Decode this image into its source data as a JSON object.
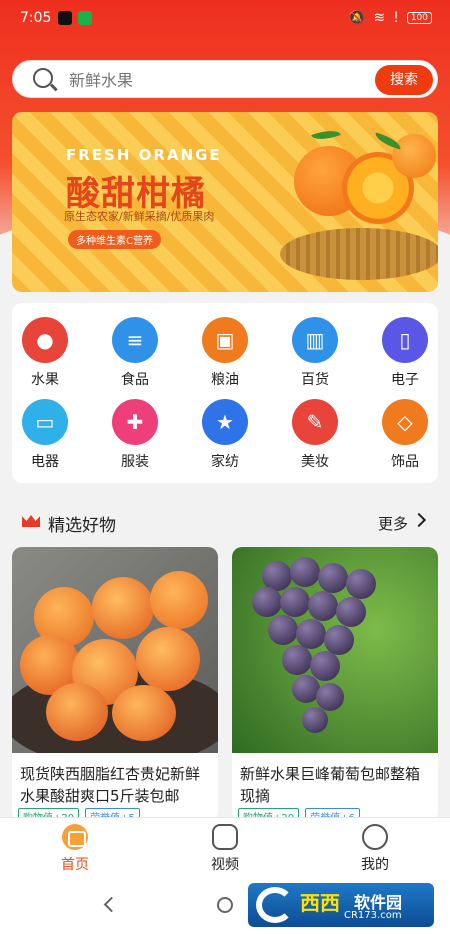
{
  "status_bar": {
    "time": "7:05",
    "battery": "100"
  },
  "search": {
    "placeholder": "新鲜水果",
    "button_label": "搜索"
  },
  "banner": {
    "en_word1": "FRESH",
    "en_word2": "ORANGE",
    "title_part1": "酸甜",
    "title_part2": "柑橘",
    "subtitle": "原生态农家/新鲜采摘/优质果肉",
    "tag": "多种维生素C营养"
  },
  "categories": [
    {
      "label": "水果",
      "icon": "apple-icon",
      "color": "#e8443a"
    },
    {
      "label": "食品",
      "icon": "fries-icon",
      "color": "#2f92e8"
    },
    {
      "label": "粮油",
      "icon": "grain-bag-icon",
      "color": "#f07a1e"
    },
    {
      "label": "百货",
      "icon": "basket-icon",
      "color": "#2f92e8"
    },
    {
      "label": "电子",
      "icon": "phone-icon",
      "color": "#5a57e6"
    },
    {
      "label": "电器",
      "icon": "tv-icon",
      "color": "#2fb0e8"
    },
    {
      "label": "服装",
      "icon": "shirt-icon",
      "color": "#ee3f7a"
    },
    {
      "label": "家纺",
      "icon": "textile-icon",
      "color": "#2f73e8"
    },
    {
      "label": "美妆",
      "icon": "cosmetics-icon",
      "color": "#e8443a"
    },
    {
      "label": "饰品",
      "icon": "necklace-icon",
      "color": "#f07a1e"
    }
  ],
  "section": {
    "title": "精选好物",
    "more_label": "更多"
  },
  "products": [
    {
      "name": "现货陕西胭脂红杏贵妃新鲜水果酸甜爽口5斤装包邮",
      "badges": [
        "购物值+20",
        "荣誉值+5"
      ]
    },
    {
      "name": "新鲜水果巨峰葡萄包邮整箱现摘",
      "badges": [
        "购物值+20",
        "荣誉值+6"
      ]
    }
  ],
  "tabbar": [
    {
      "label": "首页",
      "icon": "home-bag-icon",
      "active": true
    },
    {
      "label": "视频",
      "icon": "video-icon",
      "active": false
    },
    {
      "label": "我的",
      "icon": "profile-face-icon",
      "active": false
    }
  ],
  "watermark": {
    "brand": "西西",
    "text": "软件园",
    "domain": "CR173.com"
  }
}
